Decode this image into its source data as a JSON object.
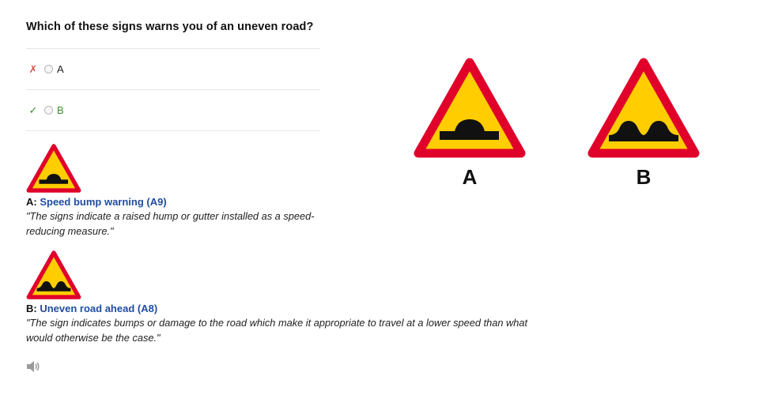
{
  "question": "Which of these signs warns you of an uneven road?",
  "options": [
    {
      "mark": "✗",
      "label": "A",
      "status": "wrong"
    },
    {
      "mark": "✓",
      "label": "B",
      "status": "correct"
    }
  ],
  "explanations": [
    {
      "letter": "A:",
      "title": "Speed bump warning (A9)",
      "quote": "\"The signs indicate a raised hump or gutter installed as a speed-reducing measure.\"",
      "icon": "speed-bump-sign-icon"
    },
    {
      "letter": "B:",
      "title": "Uneven road ahead (A8)",
      "quote": "\"The sign indicates bumps or damage to the road which make it appropriate to travel at a lower speed than what would otherwise be the case.\"",
      "icon": "uneven-road-sign-icon"
    }
  ],
  "signs": [
    {
      "label": "A",
      "icon": "speed-bump-sign-icon"
    },
    {
      "label": "B",
      "icon": "uneven-road-sign-icon"
    }
  ],
  "audio_icon": "speaker-icon",
  "colors": {
    "sign_border": "#e0002a",
    "sign_fill": "#ffcd00",
    "link": "#1f4d9e",
    "correct": "#3c8d2f",
    "wrong": "#d9534f"
  }
}
